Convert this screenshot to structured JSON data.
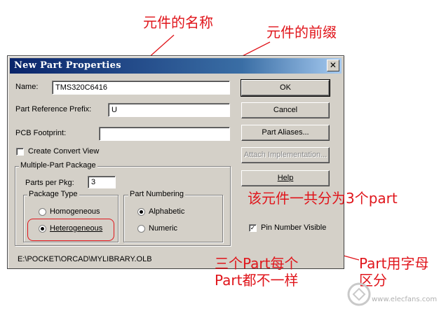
{
  "annotations": {
    "name_note": "元件的名称",
    "prefix_note": "元件的前缀",
    "parts_note": "该元件一共分为3个part",
    "hetero_note_line1": "三个Part每个",
    "hetero_note_line2": "Part都不一样",
    "alpha_note_line1": "Part用字母",
    "alpha_note_line2": "区分",
    "annotation_color": "#e0151b"
  },
  "dialog": {
    "title": "New Part Properties",
    "close_symbol": "✕",
    "name_label": "Name:",
    "name_value": "TMS320C6416",
    "prefix_label": "Part Reference Prefix:",
    "prefix_value": "U",
    "footprint_label": "PCB Footprint:",
    "footprint_value": "",
    "convert_view_label": "Create Convert View",
    "convert_view_checked": false,
    "multipart_group": "Multiple-Part Package",
    "parts_per_pkg_label": "Parts per Pkg:",
    "parts_per_pkg_value": "3",
    "package_type_group": "Package Type",
    "homogeneous_label": "Homogeneous",
    "heterogeneous_label": "Heterogeneous",
    "package_type_selected": "Heterogeneous",
    "part_numbering_group": "Part Numbering",
    "alphabetic_label": "Alphabetic",
    "numeric_label": "Numeric",
    "part_numbering_selected": "Alphabetic",
    "ok_label": "OK",
    "cancel_label": "Cancel",
    "part_aliases_label": "Part Aliases...",
    "attach_impl_label": "Attach Implementation...",
    "help_label": "Help",
    "pin_number_visible_label": "Pin Number Visible",
    "pin_number_visible_checked": true,
    "path": "E:\\POCKET\\ORCAD\\MYLIBRARY.OLB",
    "checkmark": "✓"
  },
  "watermark": "www.elecfans.com"
}
